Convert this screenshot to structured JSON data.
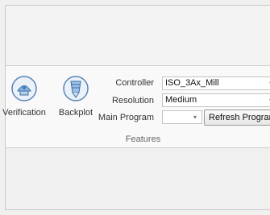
{
  "ribbon": {
    "group_label": "Features",
    "tools": [
      {
        "label": "Verification",
        "icon": "verification-icon"
      },
      {
        "label": "Backplot",
        "icon": "backplot-icon"
      }
    ],
    "fields": {
      "controller": {
        "label": "Controller",
        "value": "ISO_3Ax_Mill"
      },
      "resolution": {
        "label": "Resolution",
        "value": "Medium"
      },
      "main_program": {
        "label": "Main Program",
        "value": ""
      }
    },
    "refresh_button": "Refresh Program"
  },
  "colors": {
    "icon_blue": "#3a78c2",
    "ribbon_bg": "#f9f9f9"
  }
}
